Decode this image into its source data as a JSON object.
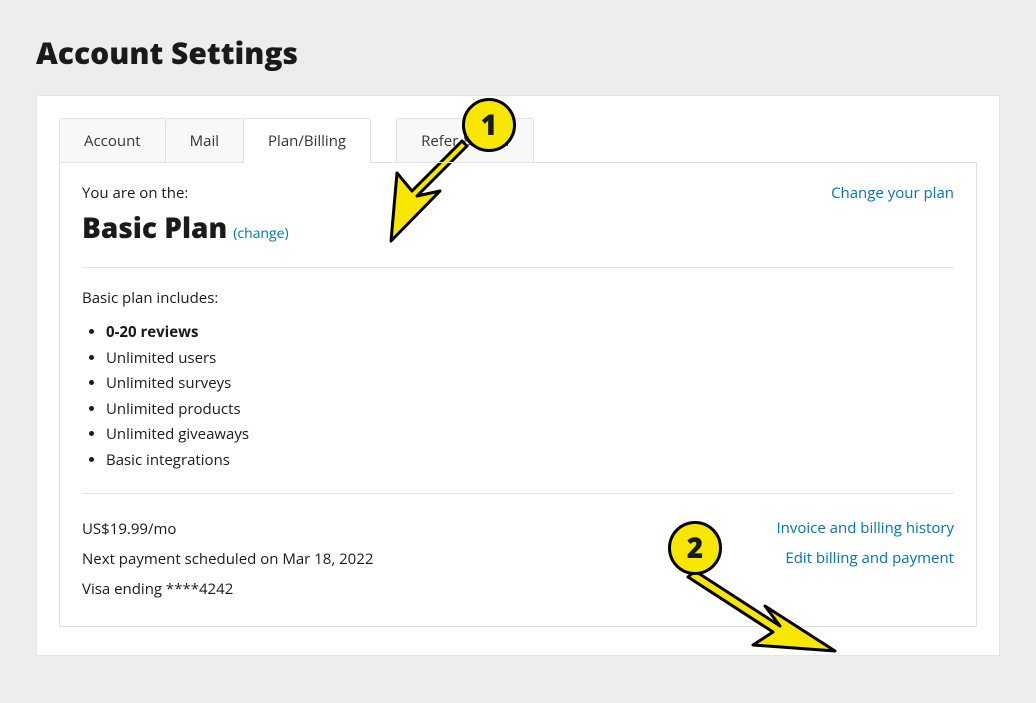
{
  "page_title": "Account Settings",
  "tabs": [
    {
      "label": "Account"
    },
    {
      "label": "Mail"
    },
    {
      "label": "Plan/Billing",
      "active": true
    },
    {
      "label": "Refer & Earn"
    }
  ],
  "plan": {
    "intro": "You are on the:",
    "name": "Basic Plan",
    "change_inline_prefix": "(",
    "change_inline_text": "change",
    "change_inline_suffix": ")",
    "change_plan_link": "Change your plan",
    "includes_label": "Basic plan includes:",
    "features": [
      {
        "text": "0-20 reviews",
        "bold": true
      },
      {
        "text": "Unlimited users"
      },
      {
        "text": "Unlimited surveys"
      },
      {
        "text": "Unlimited products"
      },
      {
        "text": "Unlimited giveaways"
      },
      {
        "text": "Basic integrations"
      }
    ]
  },
  "billing": {
    "price": "US$19.99/mo",
    "next_payment": "Next payment scheduled on Mar 18, 2022",
    "card": "Visa ending ****4242",
    "invoice_link": "Invoice and billing history",
    "edit_link": "Edit billing and payment"
  },
  "callouts": {
    "one": "1",
    "two": "2"
  }
}
